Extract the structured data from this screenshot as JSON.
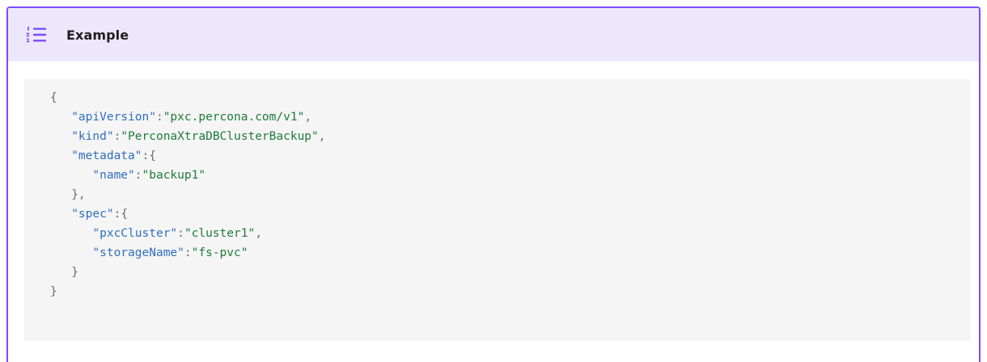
{
  "admonition": {
    "title": "Example",
    "icon": "numbered-list-icon",
    "accent_color": "#7c4dff",
    "header_bg": "#ede7fb"
  },
  "code": {
    "lines": [
      [
        {
          "t": "p",
          "v": "{"
        }
      ],
      [
        {
          "t": "p",
          "v": "   "
        },
        {
          "t": "k",
          "v": "\"apiVersion\""
        },
        {
          "t": "p",
          "v": ":"
        },
        {
          "t": "s",
          "v": "\"pxc.percona.com/v1\""
        },
        {
          "t": "p",
          "v": ","
        }
      ],
      [
        {
          "t": "p",
          "v": "   "
        },
        {
          "t": "k",
          "v": "\"kind\""
        },
        {
          "t": "p",
          "v": ":"
        },
        {
          "t": "s",
          "v": "\"PerconaXtraDBClusterBackup\""
        },
        {
          "t": "p",
          "v": ","
        }
      ],
      [
        {
          "t": "p",
          "v": "   "
        },
        {
          "t": "k",
          "v": "\"metadata\""
        },
        {
          "t": "p",
          "v": ":{"
        }
      ],
      [
        {
          "t": "p",
          "v": "      "
        },
        {
          "t": "k",
          "v": "\"name\""
        },
        {
          "t": "p",
          "v": ":"
        },
        {
          "t": "s",
          "v": "\"backup1\""
        }
      ],
      [
        {
          "t": "p",
          "v": "   },"
        }
      ],
      [
        {
          "t": "p",
          "v": "   "
        },
        {
          "t": "k",
          "v": "\"spec\""
        },
        {
          "t": "p",
          "v": ":{"
        }
      ],
      [
        {
          "t": "p",
          "v": "      "
        },
        {
          "t": "k",
          "v": "\"pxcCluster\""
        },
        {
          "t": "p",
          "v": ":"
        },
        {
          "t": "s",
          "v": "\"cluster1\""
        },
        {
          "t": "p",
          "v": ","
        }
      ],
      [
        {
          "t": "p",
          "v": "      "
        },
        {
          "t": "k",
          "v": "\"storageName\""
        },
        {
          "t": "p",
          "v": ":"
        },
        {
          "t": "s",
          "v": "\"fs-pvc\""
        }
      ],
      [
        {
          "t": "p",
          "v": "   }"
        }
      ],
      [
        {
          "t": "p",
          "v": "}"
        }
      ]
    ]
  }
}
